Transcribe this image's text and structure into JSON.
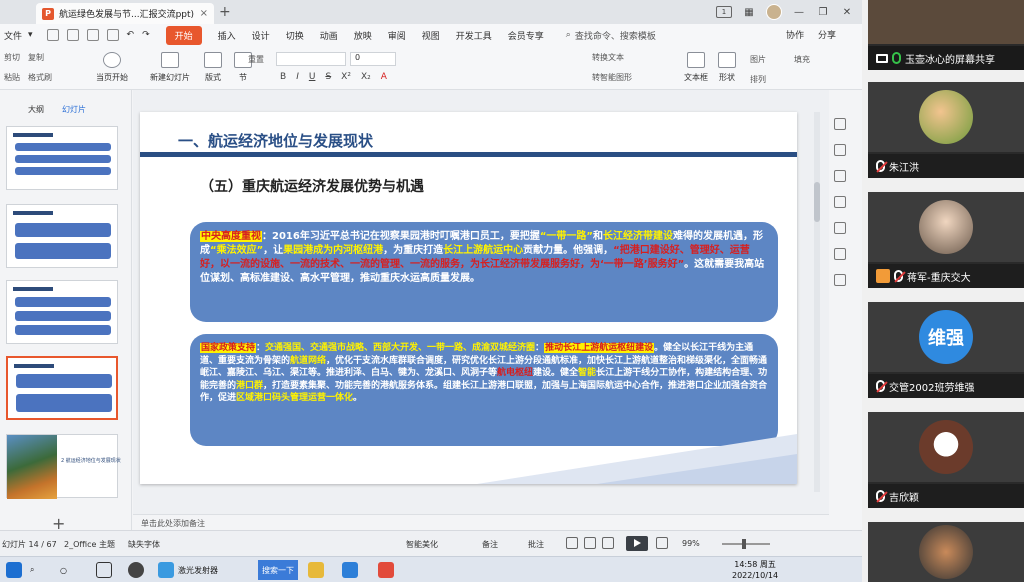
{
  "tab": {
    "title": "航运绿色发展与节...汇报交流ppt)",
    "close": "×",
    "add": "+"
  },
  "window": {
    "tile": "1",
    "min": "—",
    "max": "❐",
    "close": "✕"
  },
  "menubar": {
    "file": "文件",
    "items": [
      "开始",
      "插入",
      "设计",
      "切换",
      "动画",
      "放映",
      "审阅",
      "视图",
      "开发工具",
      "会员专享"
    ],
    "search": "查找命令、搜索模板",
    "collab": "协作",
    "share": "分享"
  },
  "ribbon": {
    "cut": "剪切",
    "paste": "粘贴",
    "copy": "复制",
    "format_painter": "格式刷",
    "from_current": "当页开始",
    "new_slide": "新建幻灯片",
    "layout": "版式",
    "section": "节",
    "reset": "重置",
    "font_size": "0",
    "textbox": "文本框",
    "shape": "形状",
    "arrange": "排列",
    "picture": "图片",
    "fill": "填充",
    "convert_art": "转换文本",
    "convert_smart": "转智能图形"
  },
  "thumbs": {
    "view_tabs": [
      "大纲",
      "幻灯片"
    ],
    "last_title": "2 航运经济地位与发展现状",
    "add": "+"
  },
  "slide": {
    "heading": "一、航运经济地位与发展现状",
    "subheading": "（五）重庆航运经济发展优势与机遇",
    "box1": {
      "tag": "中央高度重视",
      "t1": "：2016年习近平总书记在视察果园港时叮嘱港口员工，要把握",
      "t2": "“一带一路”",
      "t3": "和",
      "t4": "长江经济带建设",
      "t5": "难得的发展机遇，形成",
      "t6": "“乘法效应”",
      "t7": "，让",
      "t8": "果园港成为内河枢纽港",
      "t9": "，为重庆打造",
      "t10": "长江上游航运中心",
      "t11": "贡献力量。他强调，",
      "t12": "“把港口建设好、管理好、运营好，以一流的设施、一流的技术、一流的管理、一流的服务，为长江经济带发展服务好，为‘一带一路’服务好”",
      "t13": "。这就需要我高站位谋划、高标准建设、高水平管理，推动重庆水运高质量发展。"
    },
    "box2": {
      "tag": "国家政策支持",
      "t1": "：",
      "t2": "交通强国、交通强市战略、西部大开发、一带一路、成渝双城经济圈",
      "t3": "：",
      "t4": "推动长江上游航运枢纽建设",
      "t5": "。健全以长江干线为主通道、重要支流为骨架的",
      "t6": "航道网络",
      "t7": "，优化干支流水库群联合调度，研究优化长江上游分段通航标准，加快长江上游航道整治和梯级渠化，全面畅通岷江、嘉陵江、乌江、渠江等。推进利泽、白马、犍为、龙溪口、风洞子等",
      "t8": "航电枢纽",
      "t9": "建设。健全",
      "t10": "智能",
      "t11": "长江上游干线",
      "t12": "分工协作，构建结构合理、功能完善的",
      "t13": "港口群",
      "t14": "，打造要素集聚、功能完善的港航服务体系。组建长江上游港口联盟，加强与上海国际航运中心合作，推进港口企业加强合资合作，促进",
      "t15": "区域港口码头管理运营一体化",
      "t16": "。"
    }
  },
  "notes": {
    "placeholder": "单击此处添加备注"
  },
  "status": {
    "page": "幻灯片 14 / 67",
    "theme": "2_Office 主题",
    "missing_font": "缺失字体",
    "beautify": "智能美化",
    "notes": "备注",
    "comment": "批注",
    "zoom": "99%"
  },
  "taskbar": {
    "app1": "激光发射器",
    "input": "搜索一下",
    "time": "14:58 周五",
    "date": "2022/10/14"
  },
  "meeting": {
    "participants": [
      {
        "name": "玉壶冰心的屏幕共享",
        "kind": "share"
      },
      {
        "name": "朱江洪",
        "kind": "photo"
      },
      {
        "name": "蒋军-重庆交大",
        "kind": "photo"
      },
      {
        "name": "交管2002班劳维强",
        "kind": "avatar",
        "initials": "维强"
      },
      {
        "name": "吉欣颖",
        "kind": "photo"
      },
      {
        "name": "",
        "kind": "photo"
      }
    ]
  }
}
